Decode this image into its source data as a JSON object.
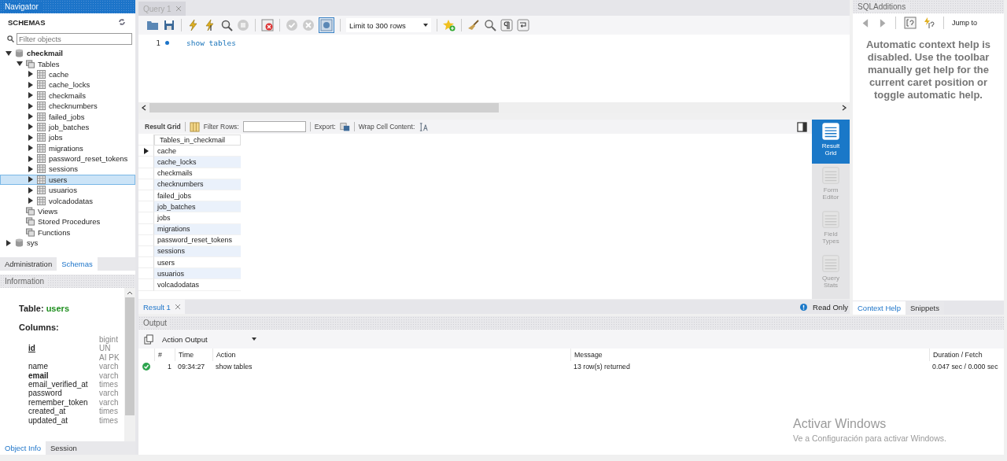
{
  "navigator": {
    "title": "Navigator",
    "schemas_label": "SCHEMAS",
    "filter_placeholder": "Filter objects",
    "schemas": [
      {
        "name": "checkmail",
        "kind": "schema",
        "expanded": true,
        "children": [
          {
            "name": "Tables",
            "kind": "folder",
            "expanded": true,
            "children": [
              {
                "name": "cache",
                "kind": "table",
                "expanded": false,
                "selected": false
              },
              {
                "name": "cache_locks",
                "kind": "table",
                "expanded": false,
                "selected": false
              },
              {
                "name": "checkmails",
                "kind": "table",
                "expanded": false,
                "selected": false
              },
              {
                "name": "checknumbers",
                "kind": "table",
                "expanded": false,
                "selected": false
              },
              {
                "name": "failed_jobs",
                "kind": "table",
                "expanded": false,
                "selected": false
              },
              {
                "name": "job_batches",
                "kind": "table",
                "expanded": false,
                "selected": false
              },
              {
                "name": "jobs",
                "kind": "table",
                "expanded": false,
                "selected": false
              },
              {
                "name": "migrations",
                "kind": "table",
                "expanded": false,
                "selected": false
              },
              {
                "name": "password_reset_tokens",
                "kind": "table",
                "expanded": false,
                "selected": false
              },
              {
                "name": "sessions",
                "kind": "table",
                "expanded": false,
                "selected": false
              },
              {
                "name": "users",
                "kind": "table",
                "expanded": false,
                "selected": true
              },
              {
                "name": "usuarios",
                "kind": "table",
                "expanded": false,
                "selected": false
              },
              {
                "name": "volcadodatas",
                "kind": "table",
                "expanded": false,
                "selected": false
              }
            ]
          },
          {
            "name": "Views",
            "kind": "folder"
          },
          {
            "name": "Stored Procedures",
            "kind": "folder"
          },
          {
            "name": "Functions",
            "kind": "folder"
          }
        ]
      },
      {
        "name": "sys",
        "kind": "schema",
        "expanded": false
      }
    ],
    "tabs": [
      {
        "label": "Administration",
        "selected": false
      },
      {
        "label": "Schemas",
        "selected": true
      }
    ]
  },
  "information": {
    "title": "Information",
    "table_label": "Table:",
    "table_name": "users",
    "columns_label": "Columns:",
    "columns": [
      {
        "name": "id",
        "kind": "primary",
        "type": [
          "bigint",
          "UN",
          "AI PK"
        ]
      },
      {
        "name": "name",
        "kind": "plain",
        "type": [
          "varch"
        ]
      },
      {
        "name": "email",
        "kind": "indexed",
        "type": [
          "varch"
        ]
      },
      {
        "name": "email_verified_at",
        "kind": "plain",
        "type": [
          "times"
        ]
      },
      {
        "name": "password",
        "kind": "plain",
        "type": [
          "varch"
        ]
      },
      {
        "name": "remember_token",
        "kind": "plain",
        "type": [
          "varch"
        ]
      },
      {
        "name": "created_at",
        "kind": "plain",
        "type": [
          "times"
        ]
      },
      {
        "name": "updated_at",
        "kind": "plain",
        "type": [
          "times"
        ]
      }
    ],
    "tabs": [
      {
        "label": "Object Info",
        "selected": true
      },
      {
        "label": "Session",
        "selected": false
      }
    ]
  },
  "query_tabs": [
    {
      "label": "Query 1",
      "selected": true
    }
  ],
  "toolbar": {
    "limit": "Limit to 300 rows",
    "auto_commit": true
  },
  "editor": {
    "lines": [
      {
        "number": "1",
        "text": "show tables"
      }
    ]
  },
  "result_toolbar": {
    "title": "Result Grid",
    "filter_label": "Filter Rows:",
    "export_label": "Export:",
    "wrap_label": "Wrap Cell Content:"
  },
  "grid": {
    "column": "Tables_in_checkmail",
    "rows": [
      {
        "value": "cache",
        "current": true
      },
      {
        "value": "cache_locks",
        "current": false
      },
      {
        "value": "checkmails",
        "current": false
      },
      {
        "value": "checknumbers",
        "current": false
      },
      {
        "value": "failed_jobs",
        "current": false
      },
      {
        "value": "job_batches",
        "current": false
      },
      {
        "value": "jobs",
        "current": false
      },
      {
        "value": "migrations",
        "current": false
      },
      {
        "value": "password_reset_tokens",
        "current": false
      },
      {
        "value": "sessions",
        "current": false
      },
      {
        "value": "users",
        "current": false
      },
      {
        "value": "usuarios",
        "current": false
      },
      {
        "value": "volcadodatas",
        "current": false
      }
    ]
  },
  "side_tabs": [
    {
      "label": "Result Grid",
      "selected": true
    },
    {
      "label": "Form Editor",
      "selected": false
    },
    {
      "label": "Field Types",
      "selected": false
    },
    {
      "label": "Query Stats",
      "selected": false
    }
  ],
  "result_tabs": [
    {
      "label": "Result 1",
      "selected": true
    }
  ],
  "read_only": "Read Only",
  "sql_additions": {
    "title": "SQLAdditions",
    "jump_to": "Jump to",
    "help_lines": [
      "Automatic context help is",
      "disabled. Use the toolbar",
      "manually get help for the",
      "current caret position or",
      "toggle automatic help."
    ],
    "tabs": [
      {
        "label": "Context Help",
        "selected": true
      },
      {
        "label": "Snippets",
        "selected": false
      }
    ]
  },
  "output": {
    "title": "Output",
    "mode": "Action Output",
    "columns": [
      "#",
      "Time",
      "Action",
      "Message",
      "Duration / Fetch"
    ],
    "rows": [
      {
        "ok": true,
        "number": "1",
        "time": "09:34:27",
        "action": "show tables",
        "message": "13 row(s) returned",
        "duration": "0.047 sec / 0.000 sec"
      }
    ]
  },
  "windows_notice": {
    "title": "Activar Windows",
    "text": "Ve a Configuración para activar Windows."
  }
}
